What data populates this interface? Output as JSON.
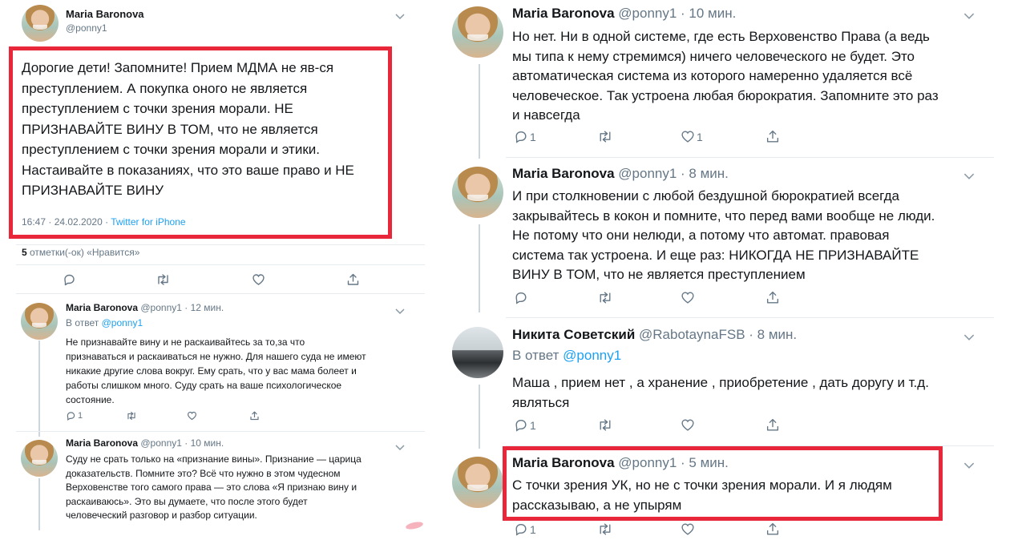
{
  "main_tweet": {
    "name": "Maria Baronova",
    "handle": "@ponny1",
    "lines": [
      "Дорогие дети! Запомните! Прием МДМА не яв-ся",
      "преступлением. А покупка оного не является",
      "преступлением с точки зрения морали. НЕ",
      "ПРИЗНАВАЙТЕ ВИНУ В ТОМ, что не является",
      "преступлением с точки зрения морали и этики.",
      "Настаивайте в показаниях, что это ваше право и НЕ",
      "ПРИЗНАВАЙТЕ ВИНУ"
    ],
    "time": "16:47 · 24.02.2020 · ",
    "source": "Twitter for iPhone",
    "likes_count": "5",
    "likes_label": " отметки(-ок) «Нравится»"
  },
  "left_replies": [
    {
      "name": "Maria Baronova",
      "handle": "@ponny1 · 12 мин.",
      "reply_prefix": "В ответ ",
      "reply_mention": "@ponny1",
      "lines": [
        "Не признавайте вину и не раскаивайтесь за то,за что",
        "признаваться и раскаиваться не нужно. Для нашего суда не имеют",
        "никакие другие слова вокруг. Ему срать, что у вас мама болеет и",
        "работы слишком много. Суду срать на ваше психологическое",
        "состояние."
      ],
      "reply_count": "1"
    },
    {
      "name": "Maria Baronova",
      "handle": "@ponny1 · 10 мин.",
      "lines": [
        "Суду не срать только на «признание вины». Признание — царица",
        "доказательств. Помните это? Всё что нужно в этом чудесном",
        "Верховенстве того самого права — это слова «Я признаю вину и",
        "раскаиваюсь». Это вы думаете, что после этого будет",
        "человеческий разговор и разбор ситуации."
      ]
    }
  ],
  "right_tweets": [
    {
      "name": "Maria Baronova",
      "handle": "@ponny1 · 10 мин.",
      "lines": [
        "Но нет. Ни в одной системе, где есть Верховенство Права (а ведь",
        "мы типа к нему стремимся) ничего человеческого не будет. Это",
        "автоматическая система из которого намеренно удаляется всё",
        "человеческое. Так устроена любая бюрократия. Запомните это раз",
        "и навсегда"
      ],
      "reply_count": "1",
      "like_count": "1"
    },
    {
      "name": "Maria Baronova",
      "handle": "@ponny1 · 8 мин.",
      "lines": [
        "И при столкновении с любой бездушной бюрократией всегда",
        "закрывайтесь в кокон и помните, что перед вами вообще не люди.",
        "Не потому что они нелюди, а потому что автомат. правовая",
        "система так устроена. И еще раз: НИКОГДА НЕ ПРИЗНАВАЙТЕ",
        "ВИНУ В ТОМ, что не является преступлением"
      ]
    },
    {
      "name": "Никита Советский",
      "handle": "@RabotaynaFSB · 8 мин.",
      "reply_prefix": "В ответ ",
      "reply_mention": "@ponny1",
      "lines": [
        "Маша , прием нет , а хранение , приобретение , дать доругу и т.д.",
        "являться"
      ],
      "reply_count": "1"
    },
    {
      "name": "Maria Baronova",
      "handle": "@ponny1 · 5 мин.",
      "lines": [
        "С точки зрения УК, но не с точки зрения морали. И я людям",
        "рассказываю, а не упырям"
      ],
      "reply_count": "1"
    }
  ],
  "icons": {
    "reply": "reply-icon",
    "retweet": "retweet-icon",
    "like": "heart-icon",
    "share": "share-icon",
    "more": "chevron-down-icon"
  },
  "colors": {
    "highlight_box": "#e8283a",
    "link": "#1da1f2",
    "muted": "#657786"
  }
}
